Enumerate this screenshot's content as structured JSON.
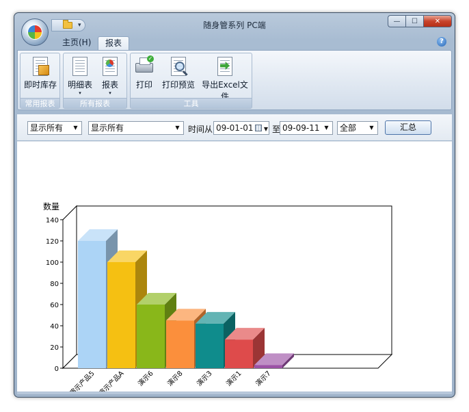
{
  "window": {
    "title": "随身管系列 PC端",
    "minimize_glyph": "—",
    "maximize_glyph": "☐",
    "close_glyph": "✕"
  },
  "quick_access": {
    "menu_glyph": "▾"
  },
  "tabs": [
    {
      "label": "主页(H)",
      "active": false
    },
    {
      "label": "报表",
      "active": true
    }
  ],
  "help_glyph": "?",
  "ribbon": {
    "groups": [
      {
        "label": "常用报表",
        "buttons": [
          {
            "label": "即时库存",
            "icon": "inventory-icon"
          }
        ]
      },
      {
        "label": "所有报表",
        "buttons": [
          {
            "label": "明细表",
            "icon": "detail-report-icon",
            "dropdown": true
          },
          {
            "label": "报表",
            "icon": "report-icon",
            "dropdown": true
          }
        ]
      },
      {
        "label": "工具",
        "buttons": [
          {
            "label": "打印",
            "icon": "printer-icon"
          },
          {
            "label": "打印预览",
            "icon": "print-preview-icon"
          },
          {
            "label": "导出Excel文件",
            "icon": "export-excel-icon"
          }
        ]
      }
    ],
    "dropdown_glyph": "▾"
  },
  "filters": {
    "filter1": "显示所有",
    "filter2": "显示所有",
    "time_from_label": "时间从",
    "date_from": "09-01-01",
    "to_label": "至",
    "date_to": "09-09-11",
    "scope": "全部",
    "dropdown_glyph": "▼",
    "summary_button": "汇总"
  },
  "chart_data": {
    "type": "bar",
    "ylabel": "数量",
    "xlabel": "",
    "ylim": [
      0,
      140
    ],
    "y_ticks": [
      0,
      20,
      40,
      60,
      80,
      100,
      120,
      140
    ],
    "grid": true,
    "three_d": true,
    "categories": [
      "演示产品5",
      "演示产品A",
      "演示6",
      "演示8",
      "演示3",
      "演示1",
      "演示7"
    ],
    "values": [
      120,
      100,
      60,
      45,
      42,
      27,
      3
    ],
    "colors": [
      "#acd4f6",
      "#f5c012",
      "#89b71a",
      "#fb8f3c",
      "#0f8c8c",
      "#de4b4b",
      "#9c52a6"
    ]
  }
}
